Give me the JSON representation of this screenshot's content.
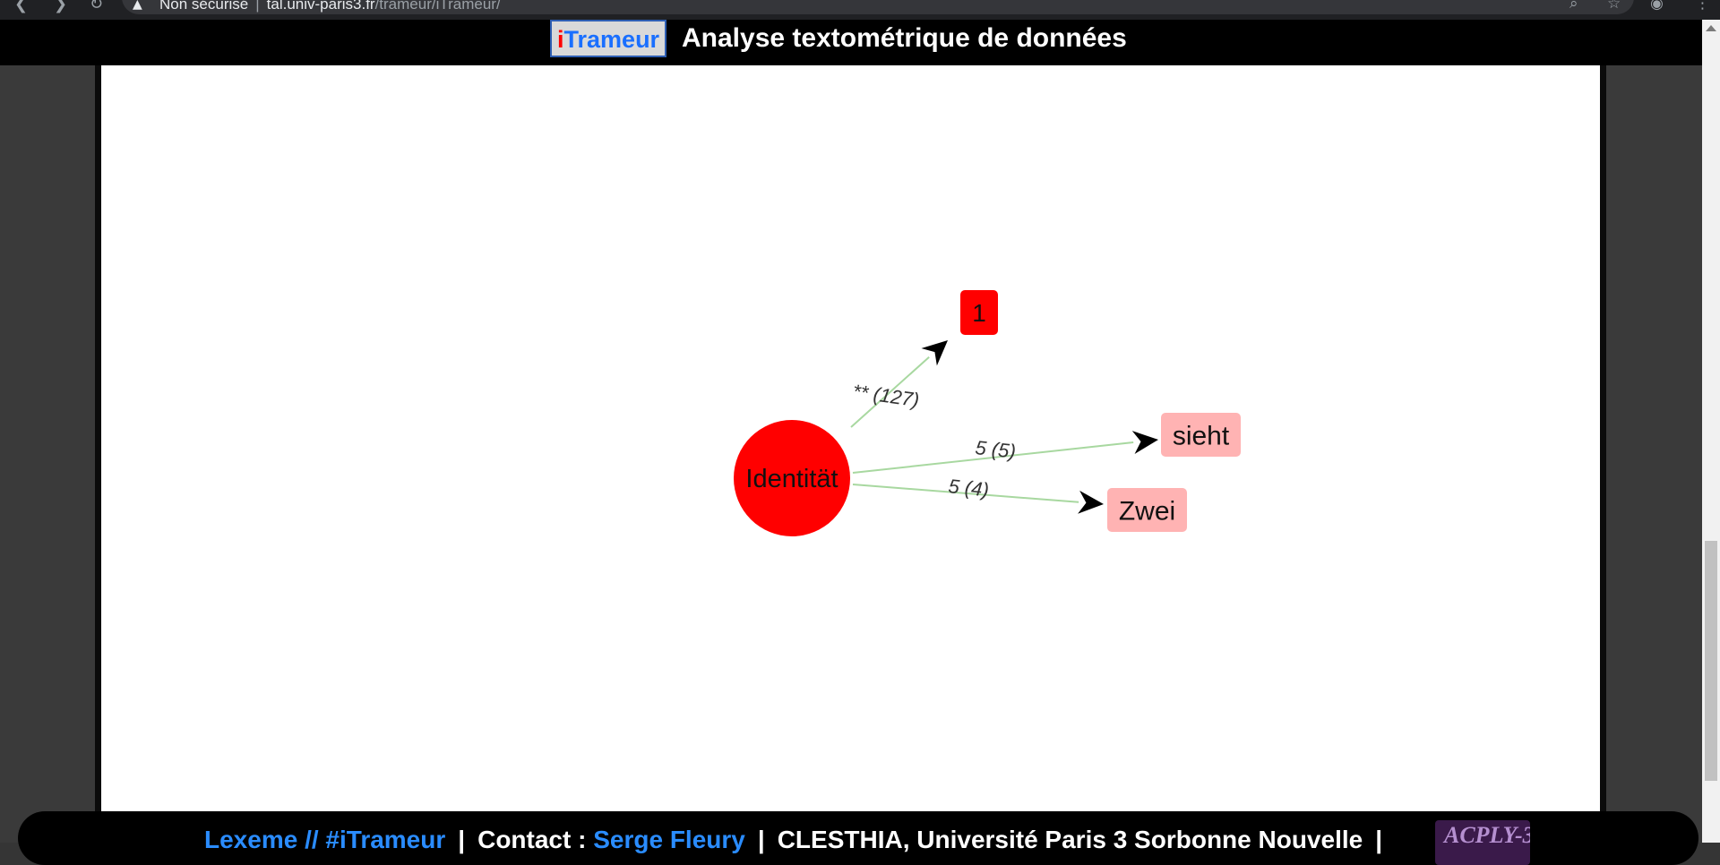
{
  "browser": {
    "back_icon": "chevron-left-icon",
    "forward_icon": "chevron-right-icon",
    "reload_icon": "reload-icon",
    "security_label": "Non sécurisé",
    "host": "tal.univ-paris3.fr",
    "path": "/trameur/iTrameur/",
    "search_icon": "search-icon",
    "bookmark_icon": "star-icon",
    "account_icon": "account-icon",
    "menu_icon": "kebab-menu-icon"
  },
  "header": {
    "logo_i": "i",
    "logo_rest": "Trameur",
    "title": "Analyse textométrique de données"
  },
  "graph": {
    "nodes": [
      {
        "id": "identitat",
        "label": "Identität",
        "shape": "circle",
        "color": "#ff0000"
      },
      {
        "id": "n1",
        "label": "1",
        "shape": "box",
        "color": "#ff0000"
      },
      {
        "id": "sieht",
        "label": "sieht",
        "shape": "box",
        "color": "#ffb3b3"
      },
      {
        "id": "zwei",
        "label": "Zwei",
        "shape": "box",
        "color": "#ffb3b3"
      }
    ],
    "edges": [
      {
        "from": "identitat",
        "to": "n1",
        "label": "** (127)"
      },
      {
        "from": "identitat",
        "to": "sieht",
        "label": "5 (5)"
      },
      {
        "from": "identitat",
        "to": "zwei",
        "label": "5 (4)"
      }
    ],
    "edge_color": "#a8d8a0"
  },
  "footer": {
    "link_1": "Lexeme // #iTrameur",
    "separator": "|",
    "contact_label": "Contact :",
    "contact_name": "Serge Fleury",
    "affiliation": "CLESTHIA, Université Paris 3 Sorbonne Nouvelle",
    "logo_text": "ACPLY-3"
  }
}
